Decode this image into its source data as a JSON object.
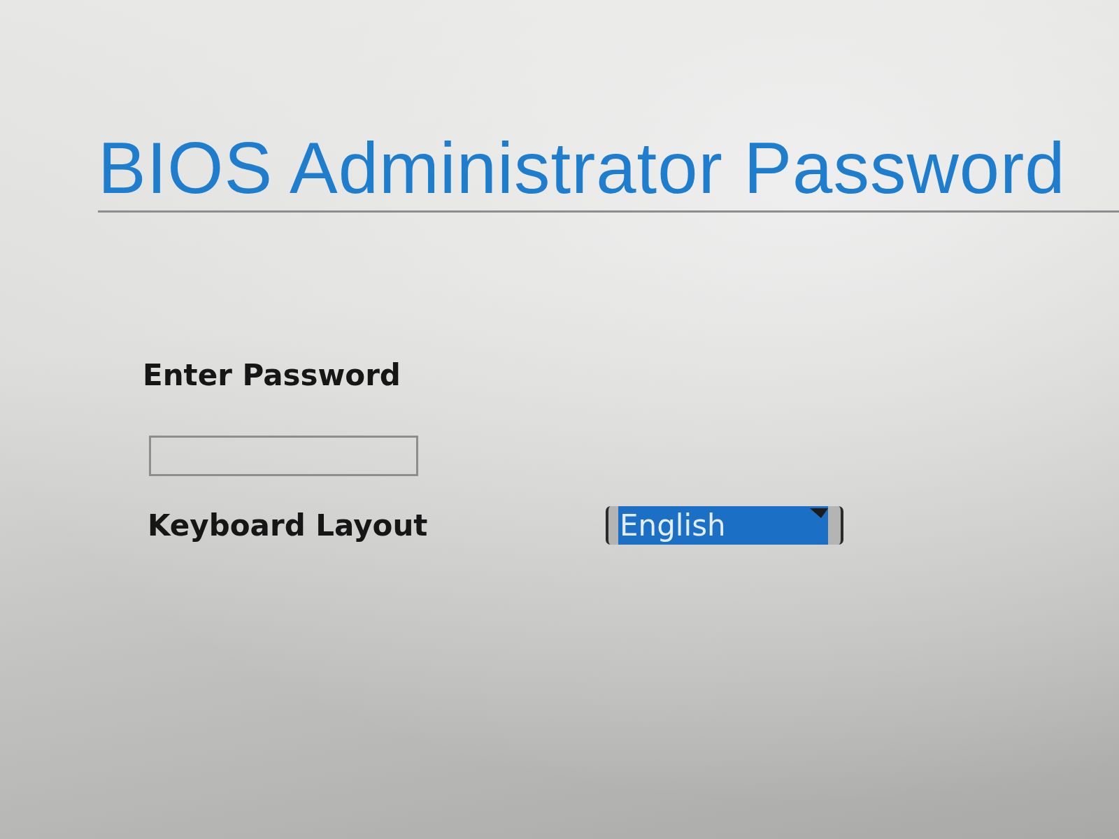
{
  "title": "BIOS Administrator Password",
  "password_field": {
    "label": "Enter Password"
  },
  "keyboard_layout": {
    "label": "Keyboard Layout",
    "value": "English",
    "focused": true
  }
}
